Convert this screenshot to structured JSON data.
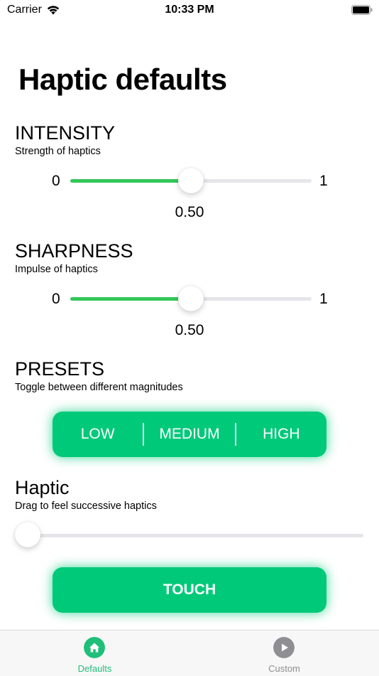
{
  "status_bar": {
    "carrier": "Carrier",
    "time": "10:33 PM",
    "icons": [
      "wifi-icon",
      "battery-icon"
    ]
  },
  "page": {
    "title": "Haptic defaults"
  },
  "intensity": {
    "title": "INTENSITY",
    "subtitle": "Strength of haptics",
    "min_label": "0",
    "max_label": "1",
    "value": 0.5,
    "value_label": "0.50"
  },
  "sharpness": {
    "title": "SHARPNESS",
    "subtitle": "Impulse of haptics",
    "min_label": "0",
    "max_label": "1",
    "value": 0.5,
    "value_label": "0.50"
  },
  "presets": {
    "title": "PRESETS",
    "subtitle": "Toggle between different magnitudes",
    "options": [
      "LOW",
      "MEDIUM",
      "HIGH"
    ]
  },
  "haptic": {
    "title": "Haptic",
    "subtitle": "Drag to feel successive haptics",
    "value": 0.0
  },
  "touch_button": {
    "label": "TOUCH"
  },
  "tab_bar": {
    "items": [
      {
        "label": "Defaults",
        "icon": "home-icon",
        "active": true
      },
      {
        "label": "Custom",
        "icon": "play-icon",
        "active": false
      }
    ]
  },
  "colors": {
    "accent": "#00c97a",
    "slider_fill": "#34c759",
    "slider_track": "#e5e5ea",
    "tab_active": "#1fbf7a",
    "tab_inactive": "#8e8e93"
  }
}
